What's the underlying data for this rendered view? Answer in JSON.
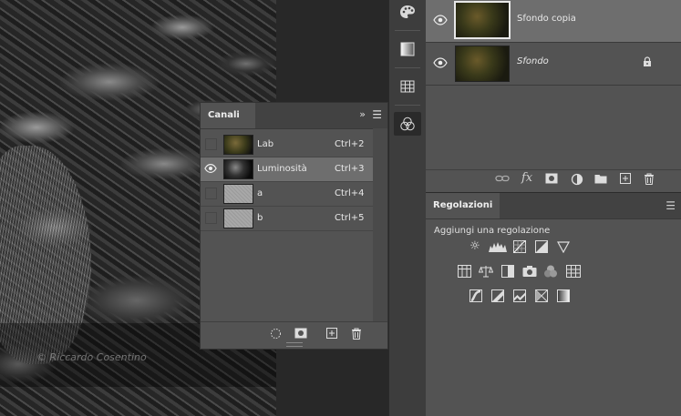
{
  "canvas": {
    "watermark": "© Riccardo Cosentino"
  },
  "toolstrip": {
    "tools": [
      {
        "name": "palette-icon"
      },
      {
        "name": "gradient-icon"
      },
      {
        "name": "table-icon"
      },
      {
        "name": "channels-icon"
      }
    ]
  },
  "layers": {
    "items": [
      {
        "name": "Sfondo copia",
        "visible": true,
        "selected": true
      },
      {
        "name": "Sfondo",
        "visible": true,
        "locked": true,
        "italic": true
      }
    ],
    "footer_icons": [
      "link-icon",
      "fx-icon",
      "mask-icon",
      "adjustment-icon",
      "folder-icon",
      "new-layer-icon",
      "trash-icon"
    ],
    "fx_label": "fx"
  },
  "regolazioni": {
    "tab": "Regolazioni",
    "hint": "Aggiungi una regolazione"
  },
  "canali": {
    "tab": "Canali",
    "collapse_glyph": "»",
    "channels": [
      {
        "name": "Lab",
        "shortcut": "Ctrl+2",
        "visible": false,
        "selected": false
      },
      {
        "name": "Luminosità",
        "shortcut": "Ctrl+3",
        "visible": true,
        "selected": true
      },
      {
        "name": "a",
        "shortcut": "Ctrl+4",
        "visible": false,
        "selected": false
      },
      {
        "name": "b",
        "shortcut": "Ctrl+5",
        "visible": false,
        "selected": false
      }
    ]
  },
  "colors": {
    "panel_bg": "#535353",
    "selected_row": "#6e6e6e",
    "tab_bar": "#424242"
  }
}
